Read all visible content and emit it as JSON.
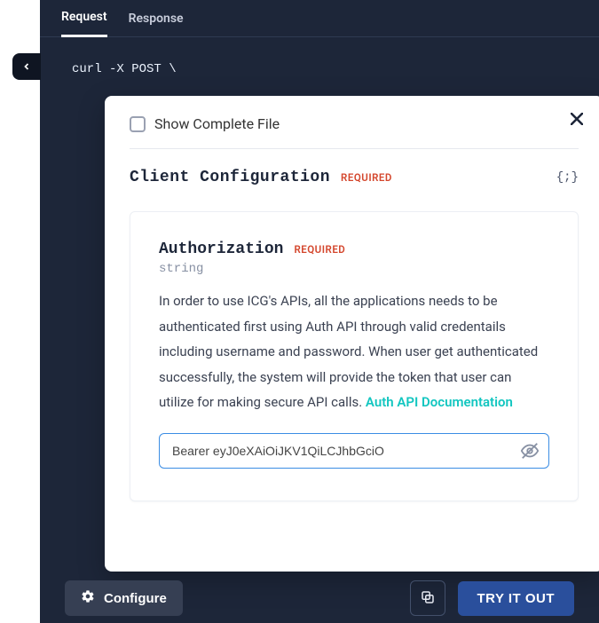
{
  "tabs": {
    "request": "Request",
    "response": "Response"
  },
  "code": {
    "line1": "curl -X POST \\"
  },
  "popover": {
    "show_complete_label": "Show Complete File",
    "section_title": "Client Configuration",
    "section_required": "REQUIRED",
    "object_glyph": "{;}",
    "field": {
      "name": "Authorization",
      "required": "REQUIRED",
      "type": "string",
      "description": "In order to use ICG's APIs, all the applications needs to be authenticated first using Auth API through valid credentails including username and password. When user get authenticated successfully, the system will provide the token that user can utilize for making secure API calls. ",
      "link_text": "Auth API Documentation",
      "input_value": "Bearer eyJ0eXAiOiJKV1QiLCJhbGciO"
    }
  },
  "bottom": {
    "configure": "Configure",
    "try": "TRY IT OUT"
  }
}
